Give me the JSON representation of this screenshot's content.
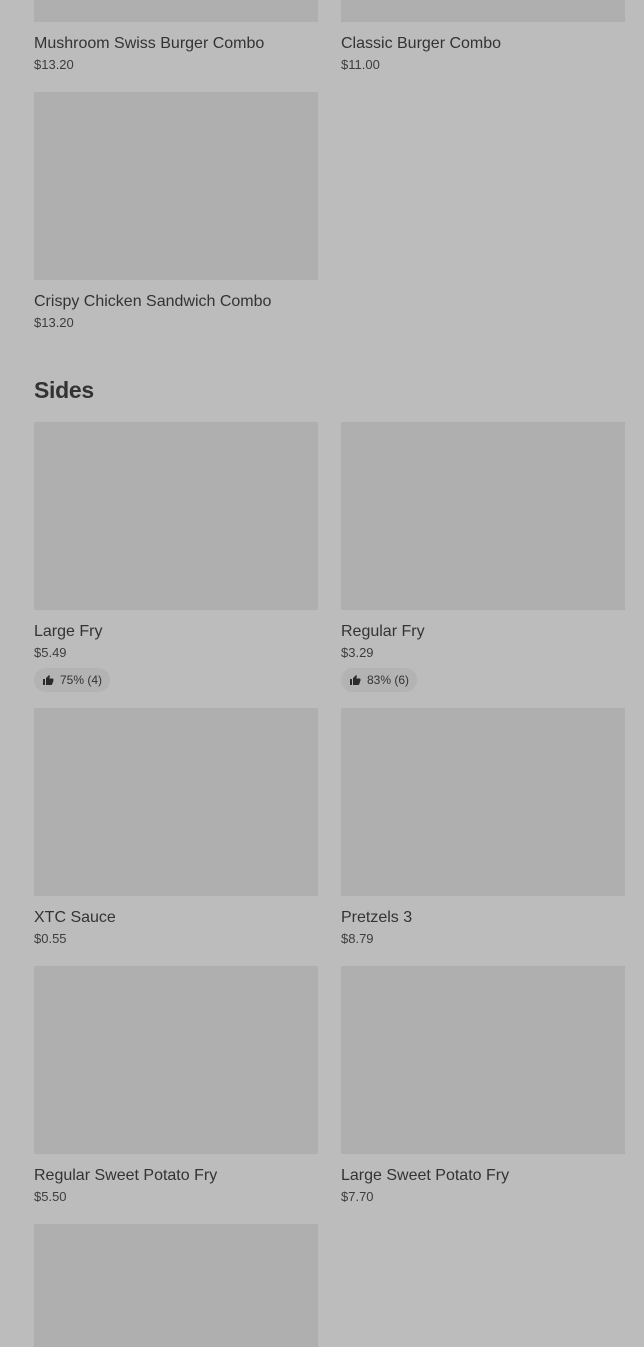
{
  "combos": {
    "items": [
      {
        "name": "Mushroom Swiss Burger Combo",
        "price": "$13.20"
      },
      {
        "name": "Classic Burger Combo",
        "price": "$11.00"
      },
      {
        "name": "Crispy Chicken Sandwich Combo",
        "price": "$13.20"
      }
    ]
  },
  "sides": {
    "title": "Sides",
    "items": [
      {
        "name": "Large Fry",
        "price": "$5.49",
        "rating": "75% (4)"
      },
      {
        "name": "Regular Fry",
        "price": "$3.29",
        "rating": "83% (6)"
      },
      {
        "name": "XTC Sauce",
        "price": "$0.55"
      },
      {
        "name": "Pretzels 3",
        "price": "$8.79"
      },
      {
        "name": "Regular Sweet Potato Fry",
        "price": "$5.50"
      },
      {
        "name": "Large Sweet Potato Fry",
        "price": "$7.70"
      }
    ]
  },
  "icons": {
    "rating": "thumbs-up-icon"
  },
  "colors": {
    "overlay": "#bcbcbc",
    "placeholder": "#afafaf",
    "text": "#333333"
  }
}
